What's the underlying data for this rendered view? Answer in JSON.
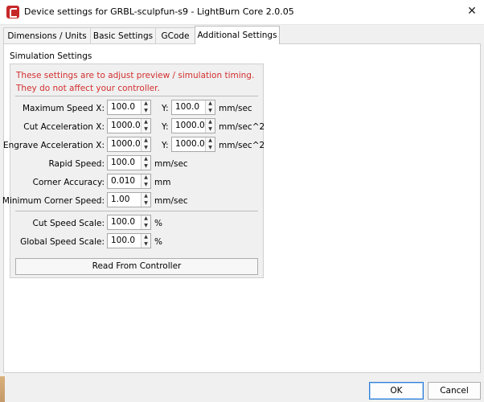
{
  "window": {
    "title": "Device settings for GRBL-sculpfun-s9 - LightBurn Core 2.0.05",
    "close_glyph": "✕"
  },
  "tabs": [
    {
      "label": "Dimensions / Units"
    },
    {
      "label": "Basic Settings"
    },
    {
      "label": "GCode"
    },
    {
      "label": "Additional Settings"
    }
  ],
  "group": {
    "title": "Simulation Settings",
    "warning_line1": "These settings are to adjust preview / simulation timing.",
    "warning_line2": "They do not affect your controller.",
    "rows": {
      "max_speed": {
        "label": "Maximum Speed X:",
        "x": "100.0",
        "y_label": "Y:",
        "y": "100.0",
        "unit": "mm/sec"
      },
      "cut_accel": {
        "label": "Cut Acceleration X:",
        "x": "1000.0",
        "y_label": "Y:",
        "y": "1000.0",
        "unit": "mm/sec^2"
      },
      "engrave_accel": {
        "label": "Engrave Acceleration X:",
        "x": "1000.0",
        "y_label": "Y:",
        "y": "1000.0",
        "unit": "mm/sec^2"
      },
      "rapid_speed": {
        "label": "Rapid Speed:",
        "value": "100.0",
        "unit": "mm/sec"
      },
      "corner_accuracy": {
        "label": "Corner Accuracy:",
        "value": "0.010",
        "unit": "mm"
      },
      "min_corner_speed": {
        "label": "Minimum Corner Speed:",
        "value": "1.00",
        "unit": "mm/sec"
      },
      "cut_speed_scale": {
        "label": "Cut Speed Scale:",
        "value": "100.0",
        "unit": "%"
      },
      "global_speed_scale": {
        "label": "Global Speed Scale:",
        "value": "100.0",
        "unit": "%"
      }
    },
    "read_button": "Read From Controller"
  },
  "footer": {
    "ok": "OK",
    "cancel": "Cancel"
  },
  "colors": {
    "warning": "#d32f2f",
    "app_icon": "#c62828",
    "primary_border": "#2f7fd9"
  },
  "icons": {
    "spin_up": "▲",
    "spin_down": "▼"
  }
}
